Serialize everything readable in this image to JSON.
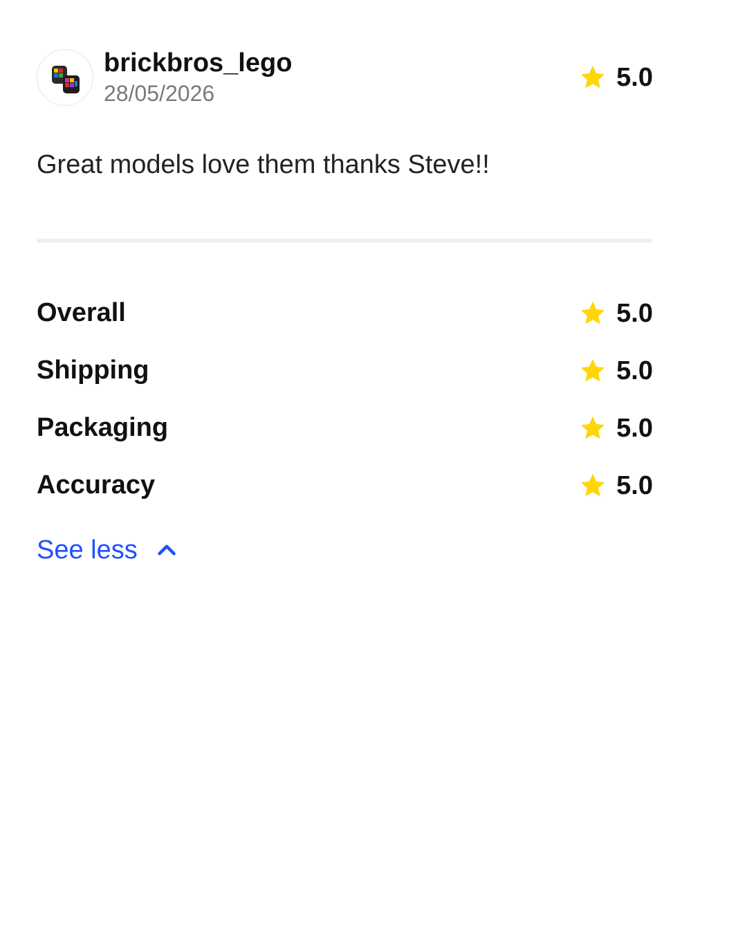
{
  "review": {
    "username": "brickbros_lego",
    "date": "28/05/2026",
    "rating": "5.0",
    "comment": "Great models love them thanks Steve!!",
    "avatar_icon": "brick-figures-avatar-icon"
  },
  "categories": [
    {
      "label": "Overall",
      "rating": "5.0"
    },
    {
      "label": "Shipping",
      "rating": "5.0"
    },
    {
      "label": "Packaging",
      "rating": "5.0"
    },
    {
      "label": "Accuracy",
      "rating": "5.0"
    }
  ],
  "toggle": {
    "label": "See less",
    "icon": "chevron-up-icon"
  },
  "colors": {
    "star": "#FFD60A",
    "link": "#1F4FFF",
    "muted": "#7A7A7A",
    "divider": "#EFEFEF"
  }
}
